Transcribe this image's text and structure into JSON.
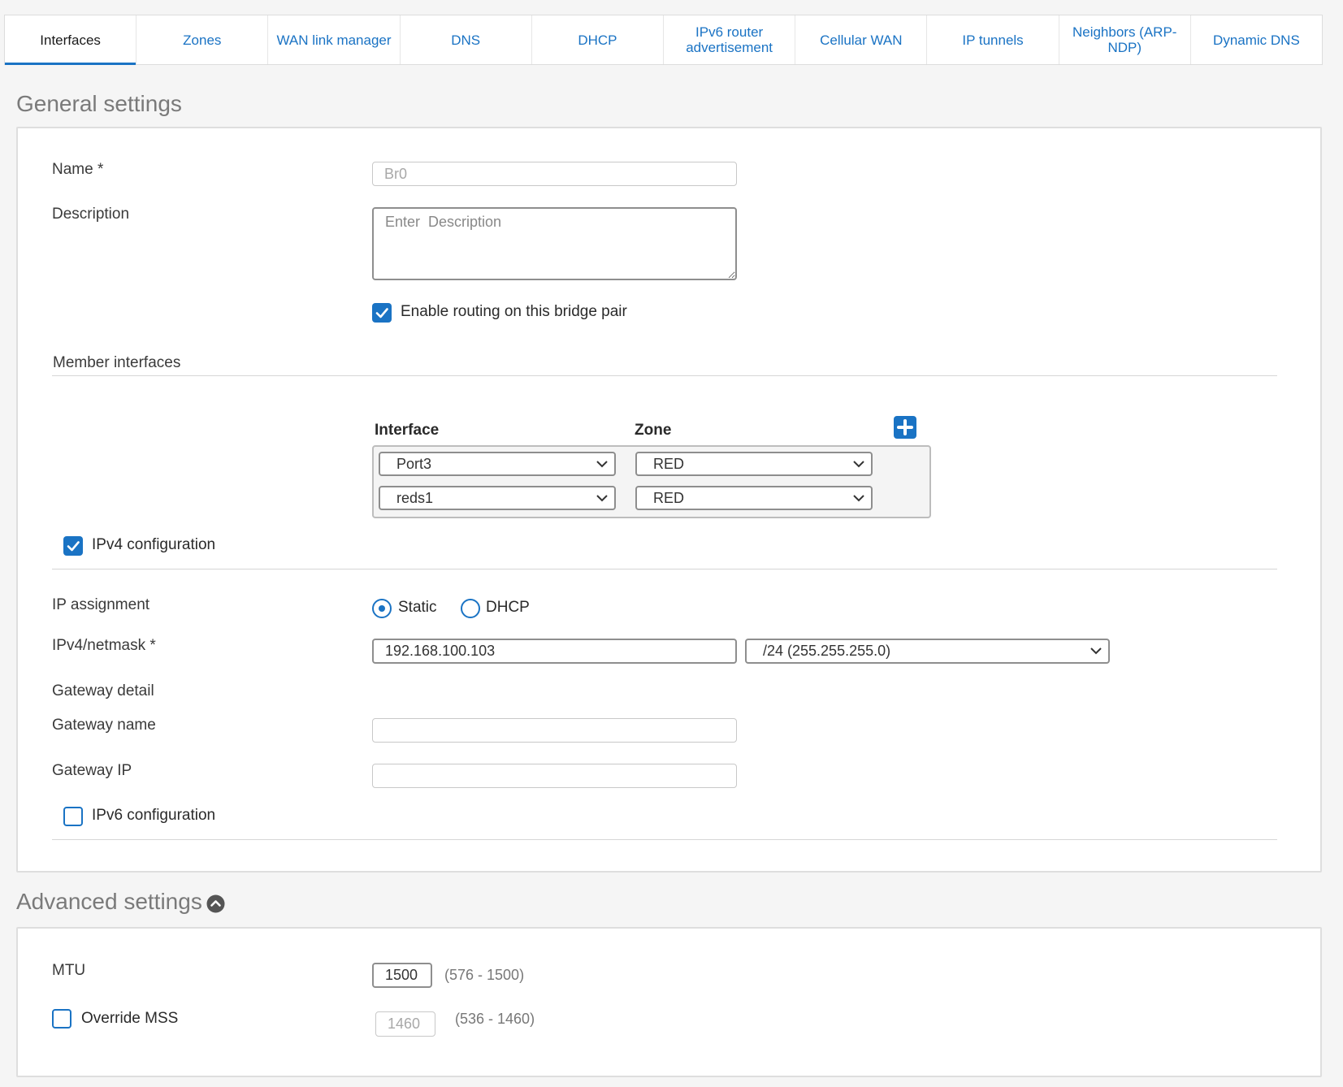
{
  "tabs": [
    {
      "label": "Interfaces",
      "active": true
    },
    {
      "label": "Zones"
    },
    {
      "label": "WAN link manager"
    },
    {
      "label": "DNS"
    },
    {
      "label": "DHCP"
    },
    {
      "label": "IPv6 router advertisement"
    },
    {
      "label": "Cellular WAN"
    },
    {
      "label": "IP tunnels"
    },
    {
      "label": "Neighbors (ARP-NDP)"
    },
    {
      "label": "Dynamic DNS"
    }
  ],
  "general": {
    "title": "General settings",
    "name_label": "Name *",
    "name_value": "Br0",
    "description_label": "Description",
    "description_placeholder": "Enter  Description",
    "enable_routing_label": "Enable routing on this bridge pair",
    "enable_routing_checked": true,
    "member_interfaces_label": "Member interfaces",
    "member_table": {
      "interface_header": "Interface",
      "zone_header": "Zone",
      "rows": [
        {
          "interface": "Port3",
          "zone": "RED"
        },
        {
          "interface": "reds1",
          "zone": "RED"
        }
      ]
    },
    "ipv4_config_label": "IPv4 configuration",
    "ipv4_config_checked": true,
    "ip_assignment_label": "IP assignment",
    "ip_assignment_options": [
      "Static",
      "DHCP"
    ],
    "ip_assignment_selected": "Static",
    "ipv4_netmask_label": "IPv4/netmask *",
    "ipv4_value": "192.168.100.103",
    "netmask_value": "/24 (255.255.255.0)",
    "gateway_detail_label": "Gateway detail",
    "gateway_name_label": "Gateway name",
    "gateway_name_value": "",
    "gateway_ip_label": "Gateway IP",
    "gateway_ip_value": "",
    "ipv6_config_label": "IPv6 configuration",
    "ipv6_config_checked": false
  },
  "advanced": {
    "title": "Advanced settings",
    "mtu_label": "MTU",
    "mtu_value": "1500",
    "mtu_range": "(576 - 1500)",
    "override_mss_label": "Override MSS",
    "override_mss_checked": false,
    "mss_value": "1460",
    "mss_range": "(536 - 1460)"
  },
  "colors": {
    "accent": "#1a73c4",
    "section_title": "#7a7a7a"
  },
  "icons": {
    "add": "plus-icon",
    "collapse": "chevron-up-circle-icon",
    "select": "chevron-down-icon",
    "check": "check-icon"
  }
}
